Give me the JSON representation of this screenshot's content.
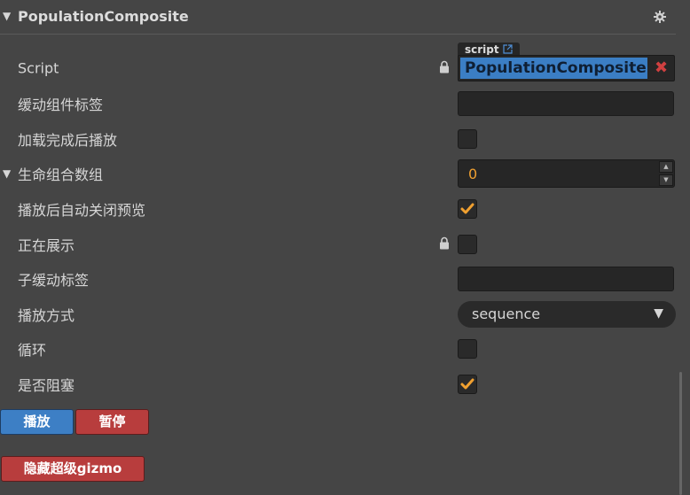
{
  "header": {
    "title": "PopulationComposite",
    "collapse_icon": "triangle-down",
    "settings_icon": "gear-icon"
  },
  "script": {
    "label": "Script",
    "tag": "script",
    "value": "PopulationComposite",
    "clear": "✖"
  },
  "rows": {
    "tween_label": {
      "label": "缓动组件标签",
      "value": ""
    },
    "play_on_load": {
      "label": "加载完成后播放",
      "checked": false
    },
    "life_group": {
      "label": "生命组合数组",
      "value": "0"
    },
    "auto_close_preview": {
      "label": "播放后自动关闭预览",
      "checked": true
    },
    "showing": {
      "label": "正在展示",
      "checked": false
    },
    "sub_tween_label": {
      "label": "子缓动标签",
      "value": ""
    },
    "play_mode": {
      "label": "播放方式",
      "value": "sequence"
    },
    "loop": {
      "label": "循环",
      "checked": false
    },
    "blocking": {
      "label": "是否阻塞",
      "checked": true
    }
  },
  "buttons": {
    "play": "播放",
    "pause": "暂停",
    "hide_gizmo": "隐藏超级gizmo"
  },
  "colors": {
    "accent_blue": "#3d7fc5",
    "accent_red": "#b83d3d",
    "check_orange": "#f0a030",
    "number_orange": "#f0a030"
  }
}
